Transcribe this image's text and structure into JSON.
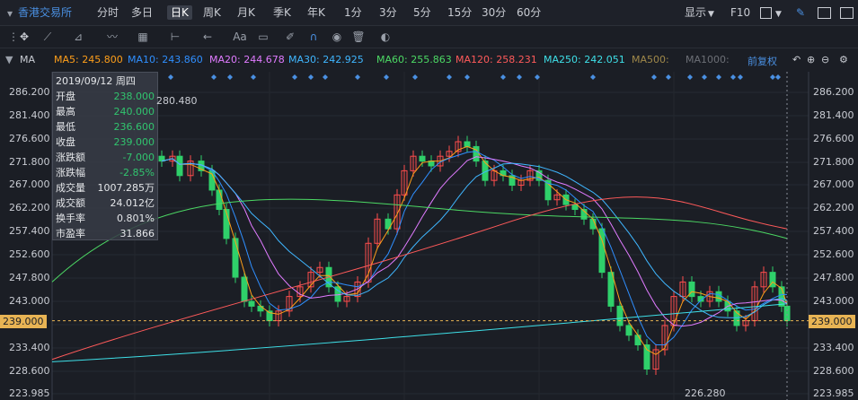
{
  "topbar": {
    "exchange": "香港交易所",
    "periods": [
      "分时",
      "多日",
      "日K",
      "周K",
      "月K",
      "季K",
      "年K",
      "1分",
      "3分",
      "5分",
      "15分",
      "30分",
      "60分"
    ],
    "selected_period": "日K",
    "display_label": "显示",
    "f10_label": "F10"
  },
  "mabar": {
    "indicator": "MA",
    "items": [
      {
        "label": "MA5: 245.800",
        "color": "#ff9f1a"
      },
      {
        "label": "MA10: 243.860",
        "color": "#2f8fff"
      },
      {
        "label": "MA20: 244.678",
        "color": "#e07bff"
      },
      {
        "label": "MA30: 242.925",
        "color": "#3fb6ff"
      },
      {
        "label": "MA60: 255.863",
        "color": "#4cd964"
      },
      {
        "label": "MA120: 258.231",
        "color": "#ff5a5a"
      },
      {
        "label": "MA250: 242.051",
        "color": "#3ee0e8"
      },
      {
        "label": "MA500:",
        "color": "#a0894a"
      },
      {
        "label": "MA1000:",
        "color": "#6c6f76"
      }
    ],
    "adjust_label": "前复权"
  },
  "tooltip": {
    "date": "2019/09/12 周四",
    "rows": [
      {
        "k": "开盘",
        "v": "238.000",
        "color": "#31c46e"
      },
      {
        "k": "最高",
        "v": "240.000",
        "color": "#31c46e"
      },
      {
        "k": "最低",
        "v": "236.600",
        "color": "#31c46e"
      },
      {
        "k": "收盘",
        "v": "239.000",
        "color": "#31c46e"
      },
      {
        "k": "涨跌额",
        "v": "-7.000",
        "color": "#31c46e"
      },
      {
        "k": "涨跌幅",
        "v": "-2.85%",
        "color": "#31c46e"
      },
      {
        "k": "成交量",
        "v": "1007.285万",
        "color": "#e5e7ea"
      },
      {
        "k": "成交额",
        "v": "24.012亿",
        "color": "#e5e7ea"
      },
      {
        "k": "换手率",
        "v": "0.801%",
        "color": "#e5e7ea"
      },
      {
        "k": "市盈率",
        "v": "31.866",
        "color": "#e5e7ea"
      }
    ]
  },
  "chart_data": {
    "type": "candlestick",
    "y_ticks": [
      "286.200",
      "281.400",
      "276.600",
      "271.800",
      "267.000",
      "262.200",
      "257.400",
      "252.600",
      "247.800",
      "243.000",
      "238.200",
      "233.400",
      "228.600",
      "223.985"
    ],
    "current_price": "239.000",
    "high_annotation": "280.480",
    "low_annotation": "226.280",
    "ylim": [
      223.985,
      291.0
    ]
  },
  "colors": {
    "up": "#ff4d4d",
    "down": "#2fd06a",
    "grid": "#2a2e36",
    "crosshair": "#8a8f99"
  }
}
